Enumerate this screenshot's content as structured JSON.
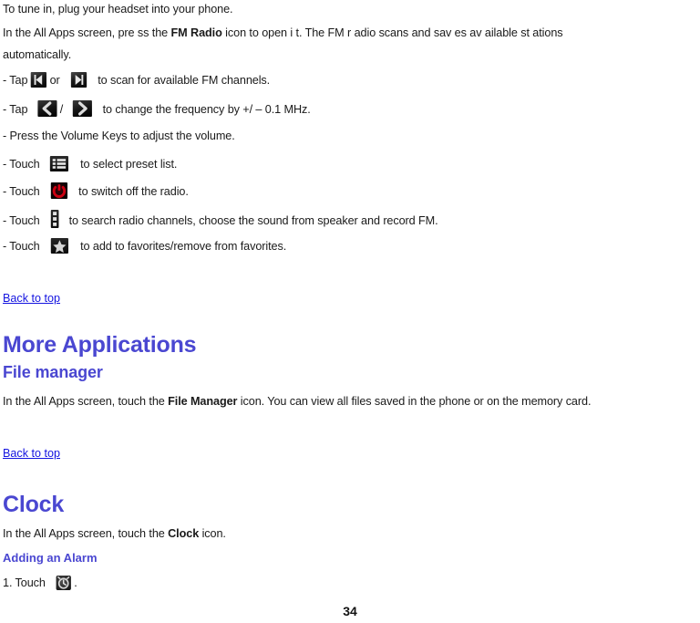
{
  "document": {
    "page_number": "34",
    "accent_heading_color": "#4a47d1",
    "link_color": "#1414e0",
    "body_color": "#1a1a1a",
    "power_icon_color": "#cc0011",
    "icon_background_color": "#111111"
  },
  "fm_radio_section": {
    "intro_line": "To tune in, plug your headset into your phone.",
    "description_part1": "In  the All   Apps screen, pre  ss the  ",
    "description_bold": "FM  Radio",
    "description_part2": "  icon to   open i t. The FM r   adio  scans and  sav es av ailable st ations",
    "description_line2": "automatically.",
    "bullets": [
      {
        "prefix": "- Tap",
        "icon_1": "skip-previous-icon",
        "separator": "or",
        "icon_2": "skip-next-icon",
        "suffix": "to scan for available FM channels."
      },
      {
        "prefix": "- Tap",
        "icon_1": "chevron-left-icon",
        "separator": "/",
        "icon_2": "chevron-right-icon",
        "suffix": "to change the frequency by +/ – 0.1 MHz."
      },
      {
        "text": "- Press the Volume Keys to adjust the volume."
      },
      {
        "prefix": "- Touch",
        "icon_1": "preset-list-icon",
        "suffix": "to select preset list."
      },
      {
        "prefix": "- Touch",
        "icon_1": "power-off-icon",
        "suffix": "to switch off the radio."
      },
      {
        "prefix": "- Touch",
        "icon_1": "overflow-menu-icon",
        "suffix": "to search radio channels, choose the sound from speaker and record FM."
      },
      {
        "prefix": "- Touch",
        "icon_1": "favorite-star-icon",
        "suffix": "to add to favorites/remove from favorites."
      }
    ],
    "back_to_top": "Back to top"
  },
  "more_applications_section": {
    "heading": "More Applications",
    "file_manager": {
      "heading": "File manager",
      "text_part1": "In the All Apps screen, touch the ",
      "text_bold": "File Manager",
      "text_part2": " icon. You can view all files saved in the phone or on the memory card."
    },
    "back_to_top": "Back to top"
  },
  "clock_section": {
    "heading": "Clock",
    "intro_part1": "In the All Apps screen, touch the ",
    "intro_bold": "Clock",
    "intro_part2": " icon.",
    "subheading": "Adding an Alarm",
    "step_1_prefix": "1. Touch",
    "step_1_icon": "add-alarm-icon",
    "step_1_suffix": "."
  }
}
